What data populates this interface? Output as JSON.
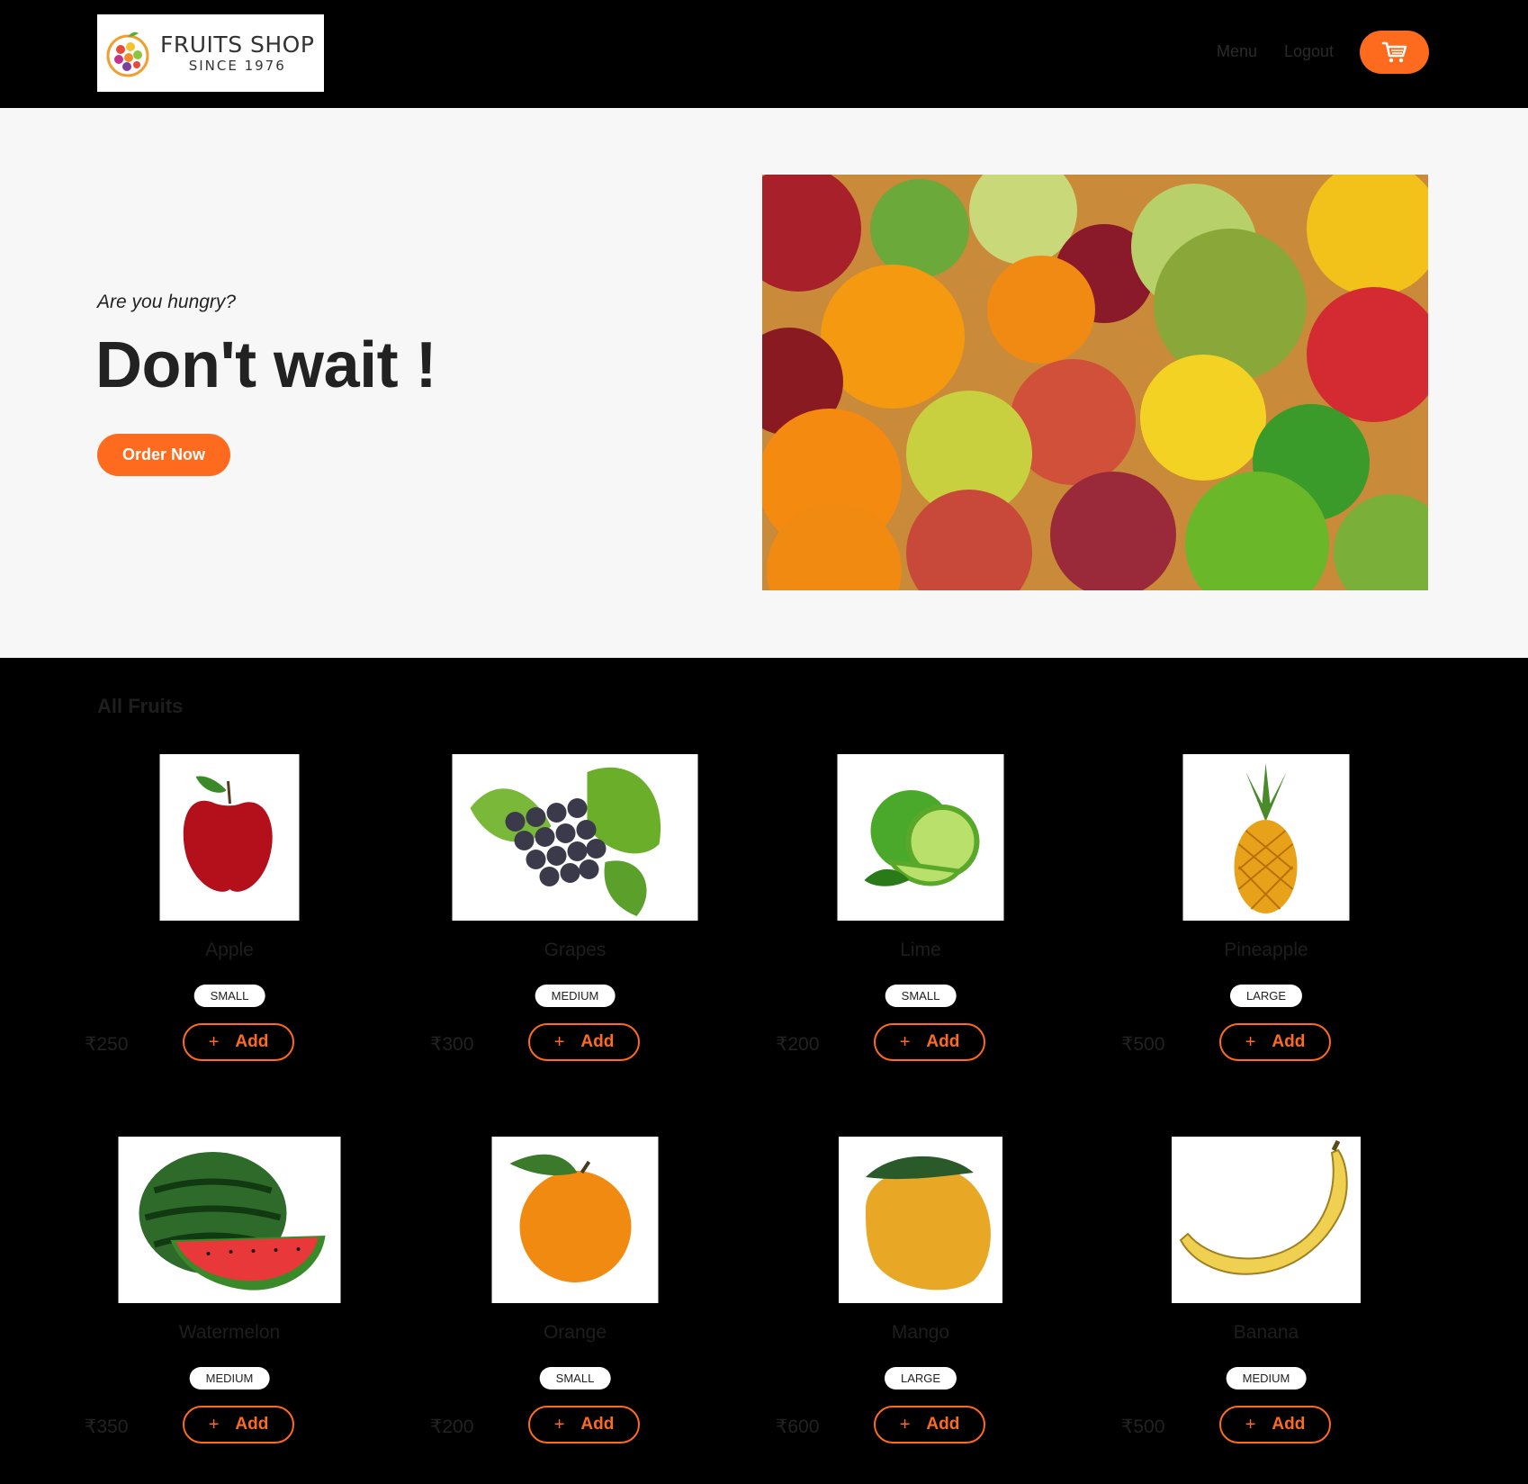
{
  "header": {
    "logo_title": "FRUITS SHOP",
    "logo_since": "SINCE 1976",
    "nav_menu": "Menu",
    "nav_logout": "Logout",
    "cart_icon": "shopping-cart-icon"
  },
  "hero": {
    "subtitle": "Are you hungry?",
    "title": "Don't wait !",
    "cta": "Order Now",
    "image": "mixed-fruits-photo"
  },
  "section_title": "All Fruits",
  "add_label": "Add",
  "add_icon": "+",
  "colors": {
    "accent": "#fe6b1e",
    "header_bg": "#000000",
    "hero_bg": "#f7f7f7"
  },
  "products": [
    {
      "name": "Apple",
      "size": "SMALL",
      "price": "₹250"
    },
    {
      "name": "Grapes",
      "size": "MEDIUM",
      "price": "₹300"
    },
    {
      "name": "Lime",
      "size": "SMALL",
      "price": "₹200"
    },
    {
      "name": "Pineapple",
      "size": "LARGE",
      "price": "₹500"
    },
    {
      "name": "Watermelon",
      "size": "MEDIUM",
      "price": "₹350"
    },
    {
      "name": "Orange",
      "size": "SMALL",
      "price": "₹200"
    },
    {
      "name": "Mango",
      "size": "LARGE",
      "price": "₹600"
    },
    {
      "name": "Banana",
      "size": "MEDIUM",
      "price": "₹500"
    }
  ]
}
